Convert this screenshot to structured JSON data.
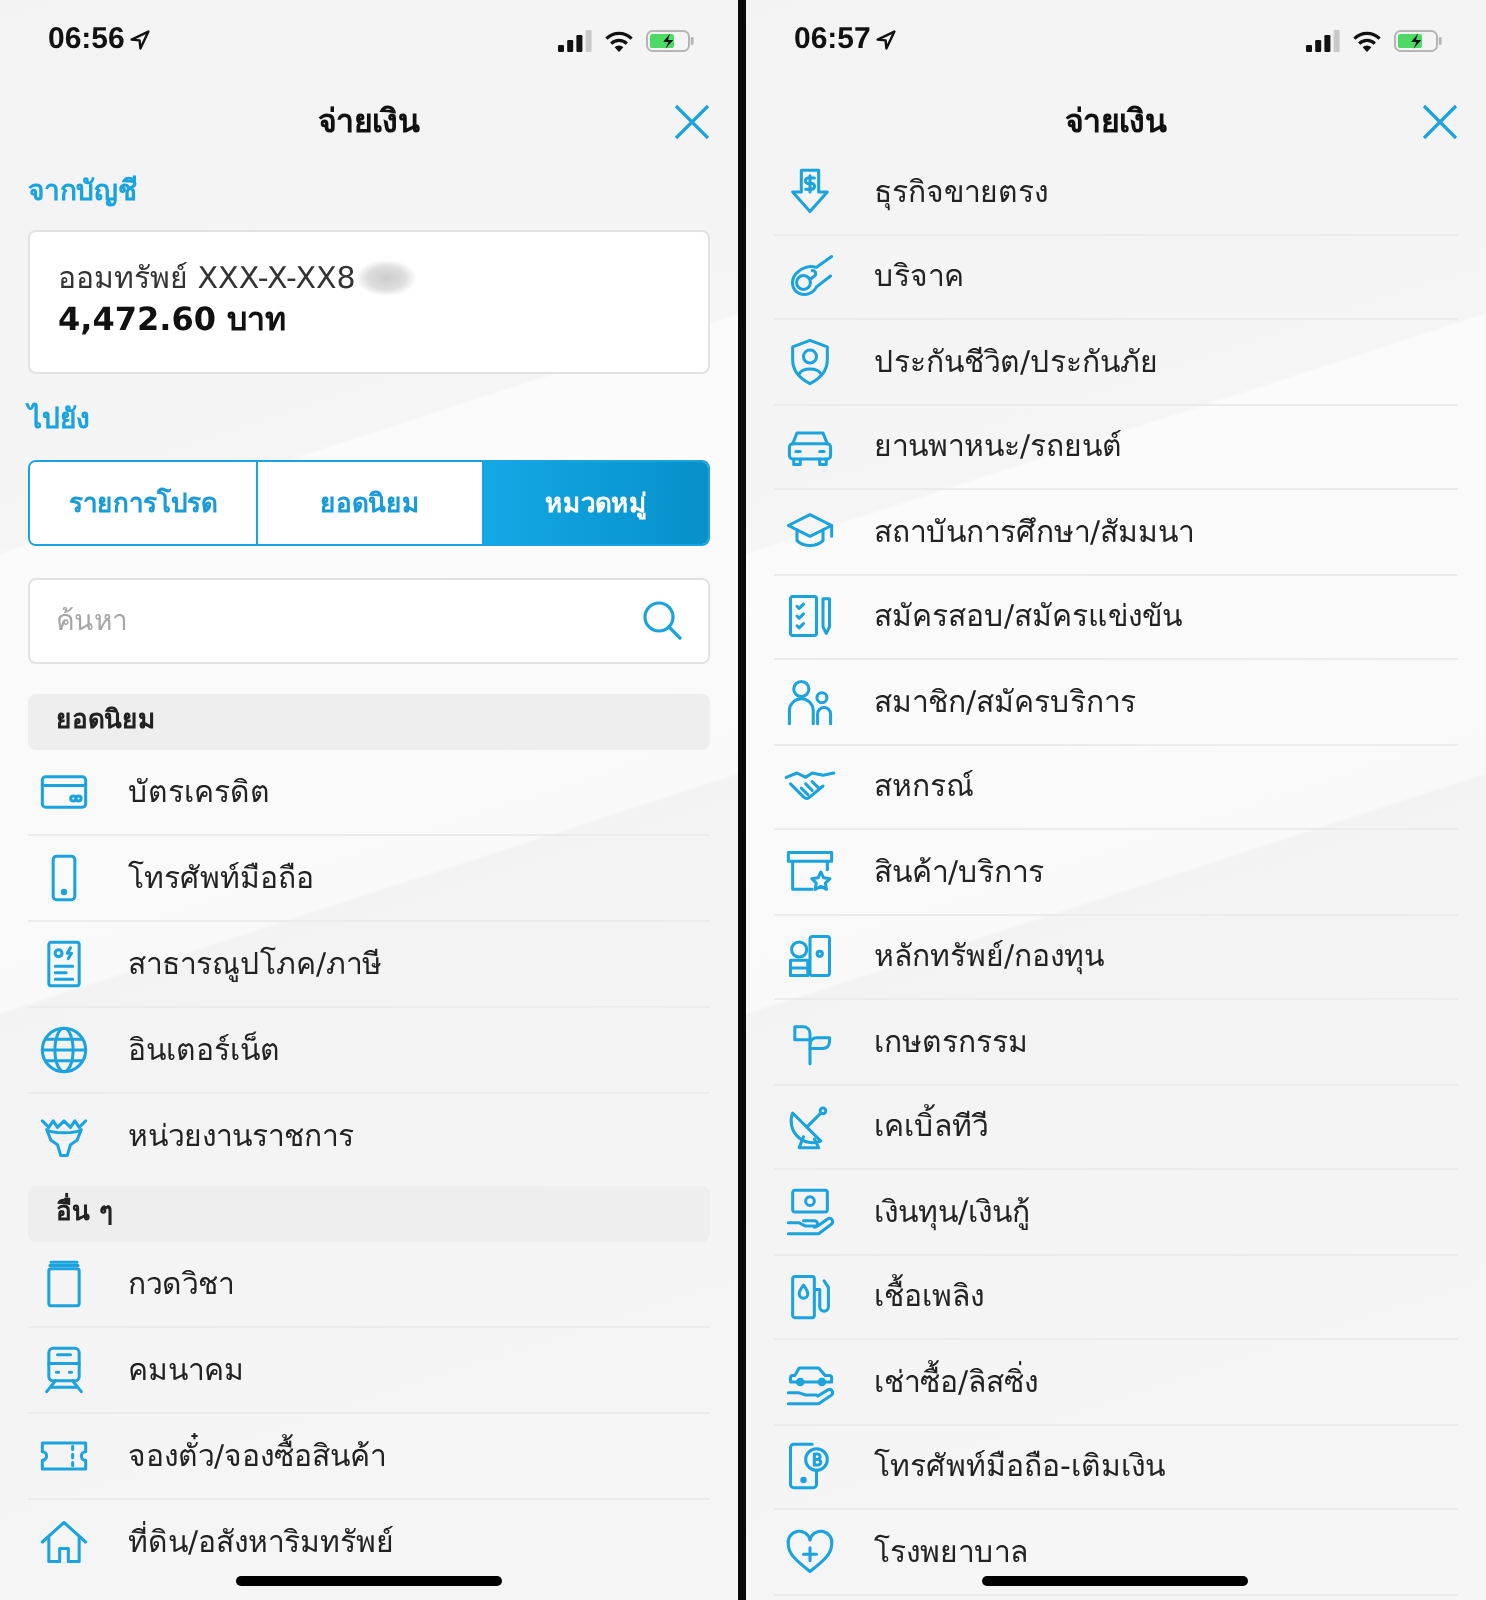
{
  "first_screen": {
    "status_bar": {
      "time": "06:56"
    },
    "header": {
      "title": "จ่ายเงิน"
    },
    "from_account": {
      "label": "จากบัญชี",
      "account": "ออมทรัพย์ XXX-X-XX8",
      "balance": "4,472.60 บาท"
    },
    "destination": {
      "label": "ไปยัง",
      "tabs": [
        {
          "label": "รายการโปรด",
          "selected": false
        },
        {
          "label": "ยอดนิยม",
          "selected": false
        },
        {
          "label": "หมวดหมู่",
          "selected": true
        }
      ]
    },
    "search": {
      "placeholder": "ค้นหา"
    },
    "sections": [
      {
        "title": "ยอดนิยม",
        "items": [
          "บัตรเครดิต",
          "โทรศัพท์มือถือ",
          "สาธารณูปโภค/ภาษี",
          "อินเตอร์เน็ต",
          "หน่วยงานราชการ"
        ]
      },
      {
        "title": "อื่น ๆ",
        "items": [
          "กวดวิชา",
          "คมนาคม",
          "จองตั๋ว/จองซื้อสินค้า",
          "ที่ดิน/อสังหาริมทรัพย์"
        ]
      }
    ]
  },
  "second_screen": {
    "status_bar": {
      "time": "06:57"
    },
    "header": {
      "title": "จ่ายเงิน"
    },
    "items": [
      "ธุรกิจขายตรง",
      "บริจาค",
      "ประกันชีวิต/ประกันภัย",
      "ยานพาหนะ/รถยนต์",
      "สถาบันการศึกษา/สัมมนา",
      "สมัครสอบ/สมัครแข่งขัน",
      "สมาชิก/สมัครบริการ",
      "สหกรณ์",
      "สินค้า/บริการ",
      "หลักทรัพย์/กองทุน",
      "เกษตรกรรม",
      "เคเบิ้ลทีวี",
      "เงินทุน/เงินกู้",
      "เชื้อเพลิง",
      "เช่าซื้อ/ลิสซิ่ง",
      "โทรศัพท์มือถือ-เติมเงิน",
      "โรงพยาบาล"
    ]
  }
}
